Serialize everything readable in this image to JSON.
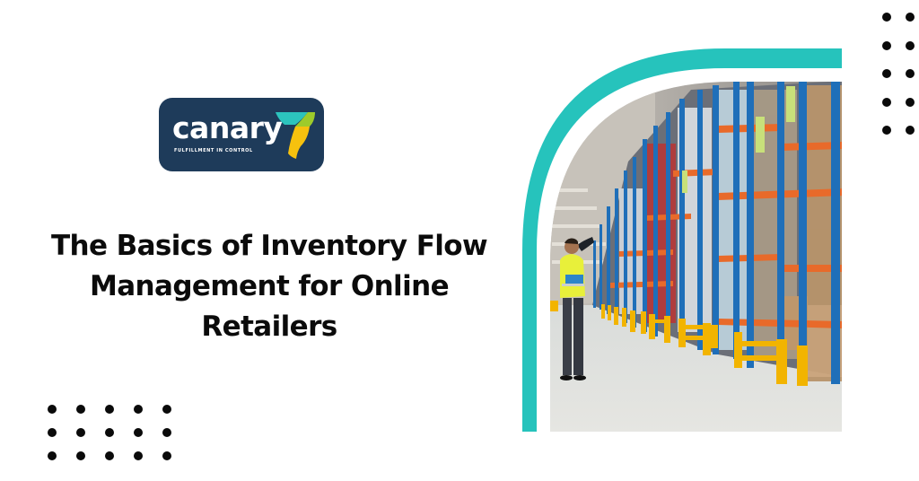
{
  "brand": {
    "name": "canary",
    "tagline": "FULFILLMENT IN CONTROL",
    "colors": {
      "badge": "#1e3b5a",
      "mark_teal": "#2cc3bd",
      "mark_green": "#9dcb2b",
      "mark_yellow": "#f6c10e"
    }
  },
  "headline": {
    "lines": [
      "The Basics of Inventory Flow",
      "Management for Online",
      "Retailers"
    ]
  },
  "decor": {
    "accent_color": "#26c3bc",
    "dot_color": "#0a0a0a",
    "bottom_left_dots": {
      "rows": 3,
      "cols": 5
    },
    "top_right_dots": {
      "rows": 5,
      "cols": 2
    }
  },
  "image": {
    "alt": "Warehouse worker in high-visibility vest holding a clipboard and pointing at tall blue and orange pallet racking",
    "icon": "warehouse-photo"
  }
}
